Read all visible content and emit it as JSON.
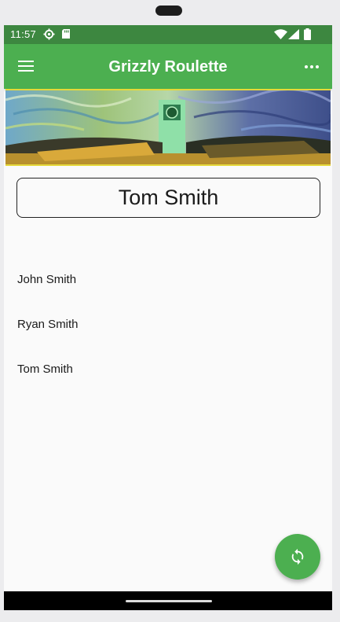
{
  "status_bar": {
    "time": "11:57",
    "icons": [
      "settings-icon",
      "sd-card-icon",
      "wifi-icon",
      "signal-icon",
      "battery-icon"
    ]
  },
  "app_bar": {
    "title": "Grizzly Roulette",
    "left_icon": "menu-icon",
    "right_icon": "more-options-icon"
  },
  "selected": {
    "name": "Tom Smith"
  },
  "names": [
    {
      "label": "John Smith"
    },
    {
      "label": "Ryan Smith"
    },
    {
      "label": "Tom Smith"
    }
  ],
  "fab": {
    "icon": "shuffle-refresh-icon"
  },
  "colors": {
    "primary": "#4caf50",
    "status_bar": "#3d8740",
    "banner_border": "#e5d83a"
  }
}
